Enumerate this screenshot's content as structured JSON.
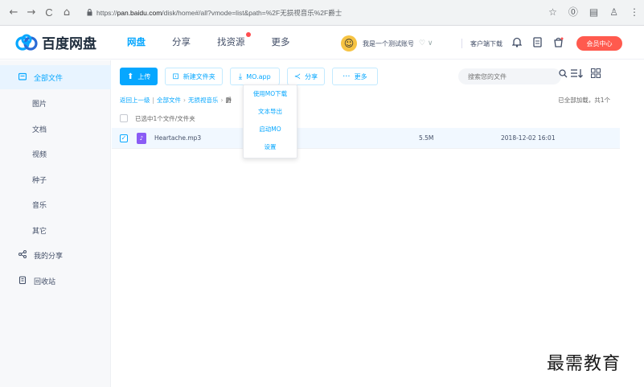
{
  "browser": {
    "back_icon": "←",
    "forward_icon": "→",
    "reload_icon": "C",
    "home_icon": "⌂",
    "lock_icon": "🔒",
    "url_scheme": "https://",
    "url_host": "pan.baidu.com",
    "url_path": "/disk/home#/all?vmode=list&path=%2F无损视音乐%2F爵士",
    "star_icon": "☆",
    "ext_icon_1": "⓪",
    "ext_icon_2": "▤",
    "ext_icon_3": "♙",
    "menu_icon": "⋮"
  },
  "header": {
    "logo_text": "百度网盘",
    "nav": [
      {
        "label": "网盘",
        "active": true
      },
      {
        "label": "分享",
        "active": false
      },
      {
        "label": "找资源",
        "active": false,
        "dot": true
      },
      {
        "label": "更多",
        "active": false
      }
    ],
    "user_name": "我是一个测试账号",
    "user_extra": "♡ ∨",
    "client_download": "客户端下载",
    "bell_icon": "🔔",
    "note_icon": "▣",
    "gift_icon": "☊",
    "vip_label": "会员中心"
  },
  "sidebar": {
    "items": [
      {
        "label": "全部文件",
        "icon": "▤",
        "active": true,
        "level": "top"
      },
      {
        "label": "图片",
        "level": "sub"
      },
      {
        "label": "文档",
        "level": "sub"
      },
      {
        "label": "视频",
        "level": "sub"
      },
      {
        "label": "种子",
        "level": "sub"
      },
      {
        "label": "音乐",
        "level": "sub"
      },
      {
        "label": "其它",
        "level": "sub"
      },
      {
        "label": "我的分享",
        "icon": "≺",
        "level": "top"
      },
      {
        "label": "回收站",
        "icon": "▥",
        "level": "top"
      }
    ]
  },
  "toolbar": {
    "upload_label": "上传",
    "upload_icon": "⬆",
    "newfolder_label": "新建文件夹",
    "newfolder_icon": "⊡",
    "mo_label": "MO.app",
    "mo_icon": "⤓",
    "share_label": "分享",
    "share_icon": "≺",
    "more_label": "更多",
    "more_icon": "···"
  },
  "search": {
    "placeholder": "搜索您的文件",
    "icon": "🔍"
  },
  "view": {
    "sort_icon": "☰↓",
    "grid_icon": "▦"
  },
  "breadcrumb": {
    "back": "返回上一级",
    "all": "全部文件",
    "folder": "无损视音乐",
    "current": "爵"
  },
  "loaded_info": "已全部加载，共1个",
  "select_info": "已选中1个文件/文件夹",
  "files": [
    {
      "name": "Heartache.mp3",
      "size": "5.5M",
      "date": "2018-12-02 16:01",
      "checked": true
    }
  ],
  "dropdown": {
    "items": [
      "使用MO下载",
      "文本导出",
      "启动MO",
      "设置"
    ]
  },
  "watermark": "最需教育",
  "colors": {
    "accent": "#06a7ff",
    "vip": "#ff5a4e",
    "selected_row": "#f1f8ff"
  }
}
